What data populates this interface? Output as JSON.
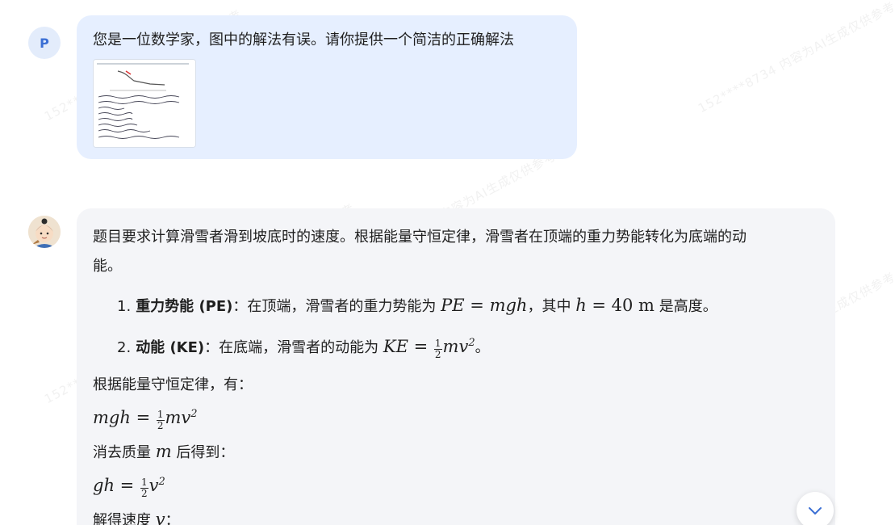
{
  "user": {
    "avatar_letter": "P",
    "message": "您是一位数学家，图中的解法有误。请你提供一个简洁的正确解法"
  },
  "assistant": {
    "intro_line1": "题目要求计算滑雪者滑到坡底时的速度。根据能量守恒定律，滑雪者在顶端的重力势能转化为底端的动",
    "intro_line2": "能。",
    "items": [
      {
        "num": "1.",
        "bold": "重力势能 (PE)",
        "text_before": "：在顶端，滑雪者的重力势能为 ",
        "math": "PE = mgh",
        "text_mid": "，其中 ",
        "math2": "h = 40 m",
        "text_after": " 是高度。"
      },
      {
        "num": "2.",
        "bold": "动能 (KE)",
        "text_before": "：在底端，滑雪者的动能为 ",
        "math": "KE = ½mv²",
        "text_after": "。"
      }
    ],
    "line_conservation": "根据能量守恒定律，有：",
    "eq1": "mgh = ½mv²",
    "line_cancel": "消去质量 m 后得到：",
    "eq2": "gh = ½v²",
    "line_solve": "解得速度 v："
  },
  "watermark": "152****8734 内容为AI生成仅供参考",
  "icons": {
    "scroll_down": "chevron-down-icon",
    "bot_avatar": "cartoon-avatar-icon"
  },
  "colors": {
    "user_bubble": "#e6efff",
    "bot_bubble": "#f4f5f8",
    "accent": "#3b6fd4"
  }
}
